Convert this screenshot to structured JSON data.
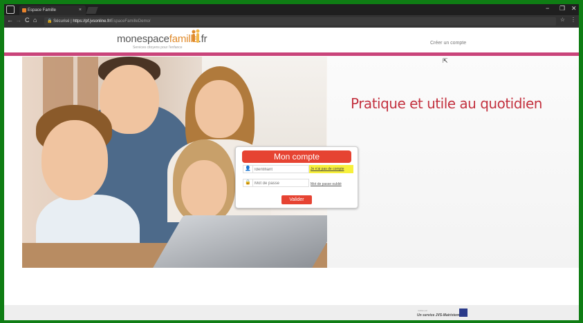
{
  "browser": {
    "tab_title": "Espace Famille",
    "tab_close": "×",
    "nav_back": "←",
    "nav_forward": "→",
    "nav_reload": "C",
    "nav_home": "⌂",
    "secure_label": "Sécurisé",
    "url_host": "https://pf.jvsonline.fr/",
    "url_path": "EspaceFamilleDemo/",
    "minimize": "−",
    "restore": "❐",
    "close": "✕",
    "star": "☆",
    "menu": "⋮"
  },
  "site": {
    "logo_main": "monespace",
    "logo_accent": "famille",
    "logo_suffix": ".fr",
    "tagline": "Services citoyens pour l'enfance",
    "create_account": "Créer un compte",
    "headline": "Pratique et utile au quotidien"
  },
  "login": {
    "title": "Mon compte",
    "username_placeholder": "Identifiant",
    "password_placeholder": "Mot de passe",
    "no_account_link": "Je n'ai pas de compte",
    "forgot_password_link": "Mot de passe oublié",
    "submit": "Valider"
  },
  "footer": {
    "small_text": "réalisé par",
    "service": "Un service JVS-Mairistem"
  },
  "colors": {
    "accent_red": "#e64332",
    "headline_red": "#c3313f",
    "pink_bar": "#c9447a",
    "highlight_yellow": "#f7f03c"
  }
}
